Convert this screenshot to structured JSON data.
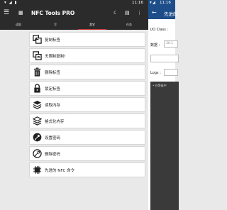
{
  "status_bar": {
    "left_time": "11:16",
    "right_time": "11:16"
  },
  "app": {
    "title": "NFC Tools PRO",
    "menu_icon": "menu-icon"
  },
  "tabs": [
    {
      "label": "读取",
      "active": false
    },
    {
      "label": "写",
      "active": false
    },
    {
      "label": "其它",
      "active": true
    },
    {
      "label": "任务",
      "active": false
    }
  ],
  "items": [
    {
      "label": "复制标签",
      "icon": "copy-tag-icon"
    },
    {
      "label": "无限制复制!",
      "icon": "unlimited-copy-icon"
    },
    {
      "label": "删除标签",
      "icon": "trash-icon"
    },
    {
      "label": "锁定标签",
      "icon": "lock-icon"
    },
    {
      "label": "读取内存",
      "icon": "layers-icon"
    },
    {
      "label": "格式化内存",
      "icon": "format-layers-icon"
    },
    {
      "label": "设置密码",
      "icon": "key-icon"
    },
    {
      "label": "删除密码",
      "icon": "remove-key-icon"
    },
    {
      "label": "先进的 NFC 命令",
      "icon": "chip-icon"
    }
  ],
  "right_panel": {
    "title": "先进的",
    "io_class_label": "I/O Class :",
    "data_label": "数据 :",
    "data_placeholder": "30.1",
    "logs_label": "Logs :",
    "log_text": "• 在等候中"
  },
  "colors": {
    "left_bar": "#2b2b2b",
    "right_bar": "#1e4e8a",
    "tab_indicator": "#d23b3b"
  }
}
